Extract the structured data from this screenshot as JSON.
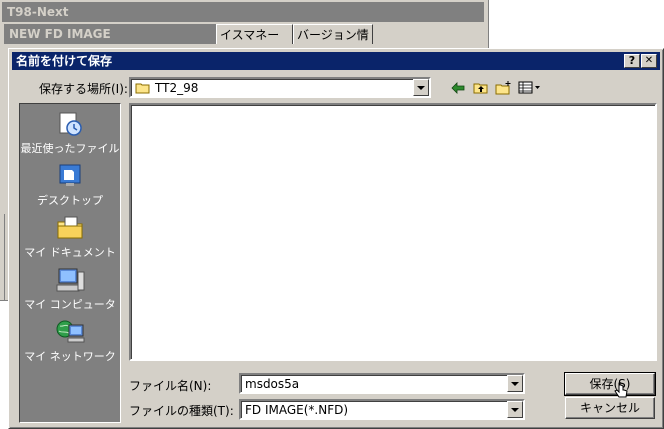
{
  "background_window": {
    "title": "T98-Next",
    "subtitle": "NEW FD IMAGE",
    "tabs": [
      "イスマネージャ",
      "バージョン情報"
    ]
  },
  "dialog": {
    "title": "名前を付けて保存",
    "help_button": "?",
    "close_button": "✕",
    "save_in_label": "保存する場所(I):",
    "save_in_value": "TT2_98",
    "places": [
      {
        "label": "最近使ったファイル",
        "icon": "recent-documents-icon"
      },
      {
        "label": "デスクトップ",
        "icon": "desktop-icon"
      },
      {
        "label": "マイ ドキュメント",
        "icon": "my-documents-icon"
      },
      {
        "label": "マイ コンピュータ",
        "icon": "my-computer-icon"
      },
      {
        "label": "マイ ネットワーク",
        "icon": "my-network-icon"
      }
    ],
    "filename_label": "ファイル名(N):",
    "filename_value": "msdos5a",
    "filetype_label": "ファイルの種類(T):",
    "filetype_value": "FD IMAGE(*.NFD)",
    "save_button": "保存(S)",
    "cancel_button": "キャンセル"
  },
  "colors": {
    "title_active": "#0a246a",
    "title_inactive": "#808080",
    "face": "#d4d0c8"
  }
}
